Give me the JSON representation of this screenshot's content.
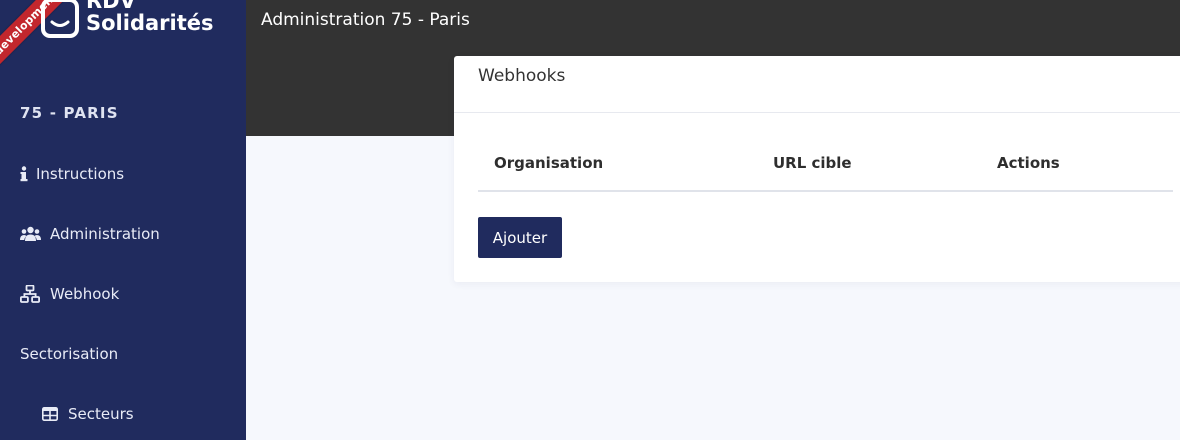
{
  "env_ribbon": "development",
  "brand": {
    "line1": "RDV",
    "line2": "Solidarités"
  },
  "sidebar": {
    "department": "75 - PARIS",
    "items": [
      {
        "label": "Instructions",
        "icon": "info-icon"
      },
      {
        "label": "Administration",
        "icon": "users-icon"
      },
      {
        "label": "Webhook",
        "icon": "network-icon"
      },
      {
        "label": "Sectorisation",
        "icon": ""
      },
      {
        "label": "Secteurs",
        "icon": "table-icon"
      }
    ]
  },
  "topbar": {
    "title": "Administration 75 - Paris"
  },
  "card": {
    "title": "Webhooks",
    "columns": [
      "Organisation",
      "URL cible",
      "Actions"
    ],
    "rows": [],
    "add_button": "Ajouter"
  },
  "colors": {
    "sidebar_bg": "#202b5e",
    "topbar_bg": "#333333",
    "primary": "#202b5e",
    "ribbon": "#c2272d"
  }
}
